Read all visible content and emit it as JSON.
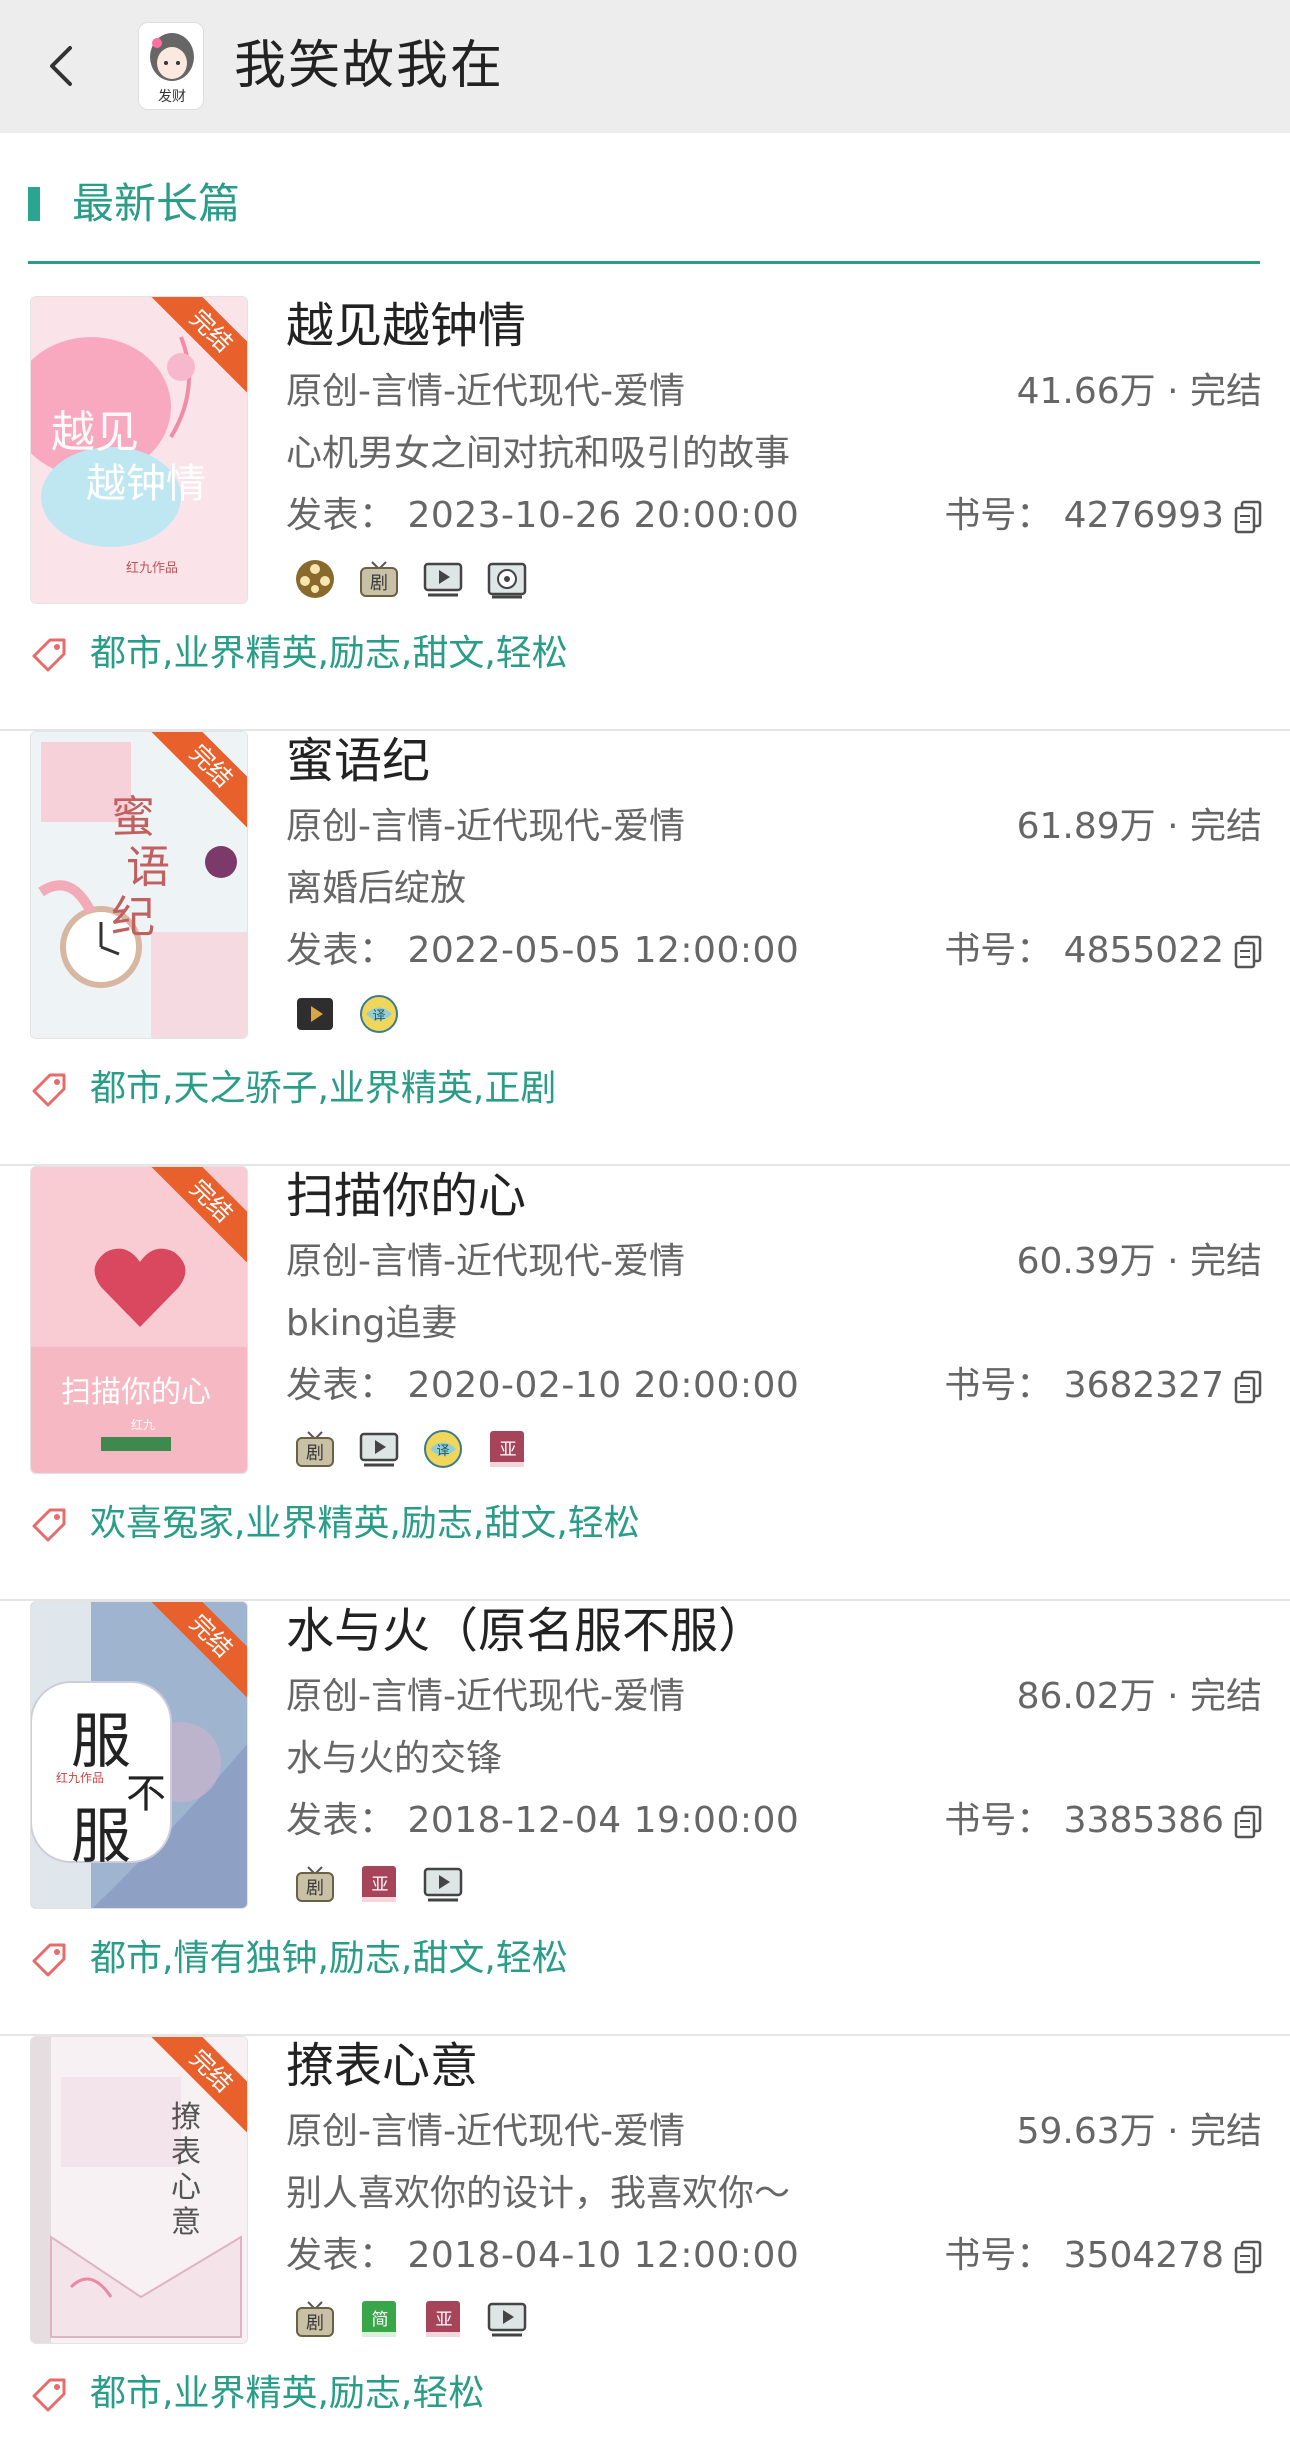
{
  "header": {
    "title": "我笑故我在",
    "avatar_caption": "发财"
  },
  "section": {
    "title": "最新长篇"
  },
  "books": [
    {
      "title": "越见越钟情",
      "category": "原创-言情-近代现代-爱情",
      "stats": "41.66万 · 完结",
      "desc": "心机男女之间对抗和吸引的故事",
      "date": "发表： 2023-10-26 20:00:00",
      "book_id": "书号： 4276993",
      "badge": "完结",
      "tags": "都市,业界精英,励志,甜文,轻松",
      "icons": [
        "film-reel-icon",
        "drama-tv-icon",
        "video-play-icon",
        "film-camera-icon"
      ],
      "cover_color": "#f7c7d3"
    },
    {
      "title": "蜜语纪",
      "category": "原创-言情-近代现代-爱情",
      "stats": "61.89万 · 完结",
      "desc": "离婚后绽放",
      "date": "发表： 2022-05-05 12:00:00",
      "book_id": "书号： 4855022",
      "badge": "完结",
      "tags": "都市,天之骄子,业界精英,正剧",
      "icons": [
        "play-box-icon",
        "translate-globe-icon"
      ],
      "cover_color": "#e8eef2"
    },
    {
      "title": "扫描你的心",
      "category": "原创-言情-近代现代-爱情",
      "stats": "60.39万 · 完结",
      "desc": "bking追妻",
      "date": "发表： 2020-02-10 20:00:00",
      "book_id": "书号： 3682327",
      "badge": "完结",
      "tags": "欢喜冤家,业界精英,励志,甜文,轻松",
      "icons": [
        "drama-tv-icon",
        "video-play-icon",
        "translate-globe-icon",
        "asia-book-icon"
      ],
      "cover_color": "#f5b8c0"
    },
    {
      "title": "水与火（原名服不服）",
      "category": "原创-言情-近代现代-爱情",
      "stats": "86.02万 · 完结",
      "desc": "水与火的交锋",
      "date": "发表： 2018-12-04 19:00:00",
      "book_id": "书号： 3385386",
      "badge": "完结",
      "tags": "都市,情有独钟,励志,甜文,轻松",
      "icons": [
        "drama-tv-icon",
        "asia-book-icon",
        "video-play-icon"
      ],
      "cover_color": "#8ea0c4"
    },
    {
      "title": "撩表心意",
      "category": "原创-言情-近代现代-爱情",
      "stats": "59.63万 · 完结",
      "desc": "别人喜欢你的设计，我喜欢你～",
      "date": "发表： 2018-04-10 12:00:00",
      "book_id": "书号： 3504278",
      "badge": "完结",
      "tags": "都市,业界精英,励志,轻松",
      "icons": [
        "drama-tv-icon",
        "simplified-book-icon",
        "asia-book-icon",
        "video-play-icon"
      ],
      "cover_color": "#f4f0f2"
    }
  ],
  "icon_labels": {
    "drama": "剧",
    "asia": "亚",
    "simplified": "简"
  },
  "colors": {
    "accent": "#2a9d88",
    "badge": "#e8602c",
    "tag": "#e86a6a"
  }
}
